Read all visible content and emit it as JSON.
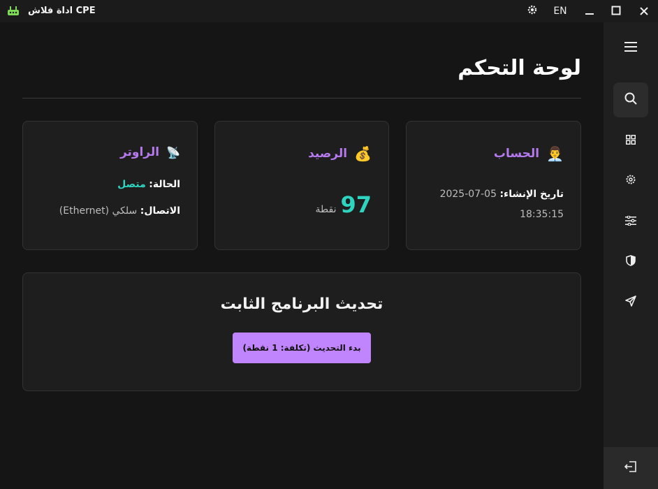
{
  "titlebar": {
    "app_title": "CPE اداة فلاش",
    "lang": "EN"
  },
  "page": {
    "title": "لوحة التحكم"
  },
  "account": {
    "title": "الحساب",
    "emoji": "👨‍💼",
    "created_label": "تاريخ الإنشاء:",
    "created_value": "05-07-2025 18:35:15"
  },
  "balance": {
    "title": "الرصيد",
    "emoji": "💰",
    "value": "97",
    "unit": "نقطة"
  },
  "router": {
    "title": "الراوتر",
    "emoji": "📡",
    "status_label": "الحالة:",
    "status_value": "متصل",
    "conn_label": "الاتصال:",
    "conn_value": "سلكي (Ethernet)"
  },
  "firmware": {
    "title": "تحديث البرنامج الثابت",
    "button_label": "بدء التحديث (تكلفة: 1 نقطة)"
  },
  "sidebar": {
    "items": [
      "menu-icon",
      "search-icon",
      "grid-icon",
      "gear-icon",
      "sliders-icon",
      "shield-icon",
      "send-icon"
    ],
    "bottom": "logout-icon"
  },
  "colors": {
    "accent": "#c084fc",
    "heading": "#b57bee",
    "success": "#2dd4bf"
  }
}
